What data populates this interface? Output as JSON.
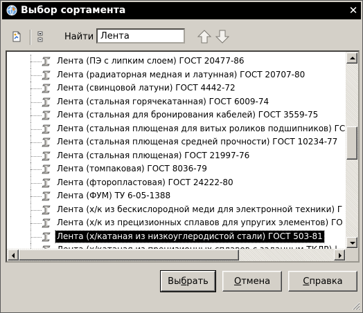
{
  "window": {
    "title": "Выбор сортамента",
    "close_glyph": "✕",
    "icon": "globe-app-icon"
  },
  "toolbar": {
    "find_label": "Найти",
    "search_value": "Лента",
    "icons": [
      "document-icon",
      "tree-toggle-icon",
      "arrow-up-icon",
      "arrow-down-icon"
    ]
  },
  "list": {
    "item_icon": "profile-i-beam-icon",
    "selected_index": 13,
    "items": [
      "Лента (ПЭ  с липким слоем) ГОСТ 20477-86",
      "Лента (радиаторная медная и латунная) ГОСТ 20707-80",
      "Лента (свинцовой латуни) ГОСТ 4442-72",
      "Лента (стальная горячекатанная) ГОСТ 6009-74",
      "Лента (стальная для бронирования кабелей) ГОСТ 3559-75",
      "Лента (стальная плющеная для витых роликов подшипников) ГС",
      "Лента (стальная плющеная средней прочности) ГОСТ 10234-77",
      "Лента (стальная плющеная) ГОСТ 21997-76",
      "Лента (томпаковая) ГОСТ 8036-79",
      "Лента (фторопластовая) ГОСТ 24222-80",
      "Лента (ФУМ) ТУ 6-05-1388",
      "Лента (х/к из бескислородной меди для электронной техники) Г",
      "Лента (х/к из прецизионных сплавов для упругих элементов) ГО",
      "Лента (х/катаная из низкоуглеродистой стали) ГОСТ 503-81",
      "Лента (х/катаная из прецизионных сплавов с заданным ТКЛР) |"
    ]
  },
  "scrollbars": {
    "vertical_position": 0.45,
    "horizontal_position": 0.0
  },
  "buttons": {
    "select": {
      "pre": "Вы",
      "accel": "б",
      "post": "рать"
    },
    "cancel": {
      "pre": "",
      "accel": "О",
      "post": "тмена"
    },
    "help": {
      "pre": "",
      "accel": "С",
      "post": "правка"
    }
  },
  "colors": {
    "title_bar": "#000000",
    "dialog_face": "#d4d0c8",
    "selection": "#000000"
  }
}
